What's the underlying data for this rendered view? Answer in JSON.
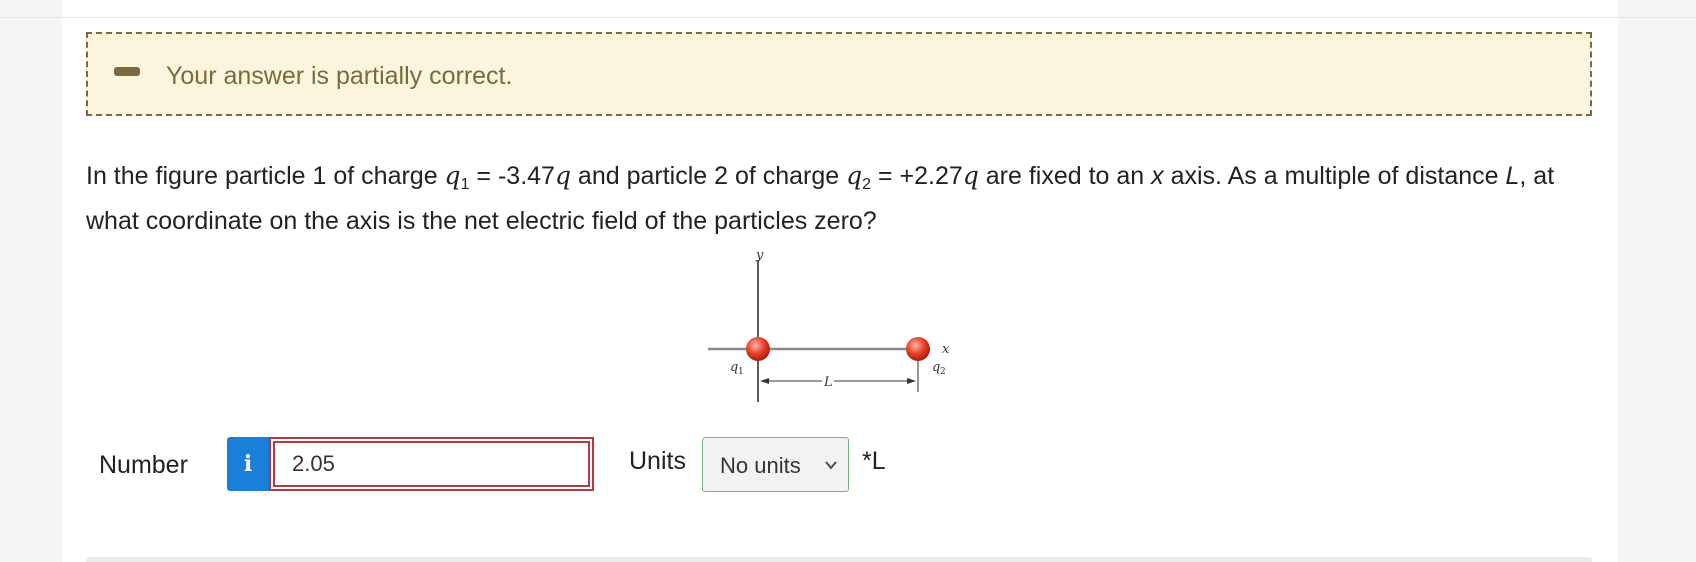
{
  "feedback": {
    "message": "Your answer is partially correct.",
    "status_icon": "partial-dash-icon",
    "color": "#7a6a3e",
    "background": "#fcf5de"
  },
  "question": {
    "part1": "In the figure particle 1 of charge ",
    "q1_var": "q",
    "q1_sub": "1",
    "q1_eq": " = -3.47",
    "q1_unit": "q",
    "part2": " and particle 2 of charge ",
    "q2_var": "q",
    "q2_sub": "2",
    "q2_eq": " = +2.27",
    "q2_unit": "q",
    "part3": " are fixed to an ",
    "x_word": "x",
    "part4": " axis. As a multiple of distance ",
    "L_word": "L",
    "part5": ", at what coordinate on the axis is the net electric field of the particles zero?"
  },
  "figure": {
    "y_label": "y",
    "x_label": "x",
    "q1_label": "q",
    "q1_sub": "1",
    "q2_label": "q",
    "q2_sub": "2",
    "L_label": "L",
    "particle_color": "#e8402a"
  },
  "answer": {
    "number_label": "Number",
    "info_icon": "info-icon",
    "info_glyph": "i",
    "value": "2.05",
    "units_label": "Units",
    "units_selected": "No units",
    "units_suffix": "*L",
    "error_color": "#b33a3a",
    "info_color": "#1a7fd8"
  }
}
